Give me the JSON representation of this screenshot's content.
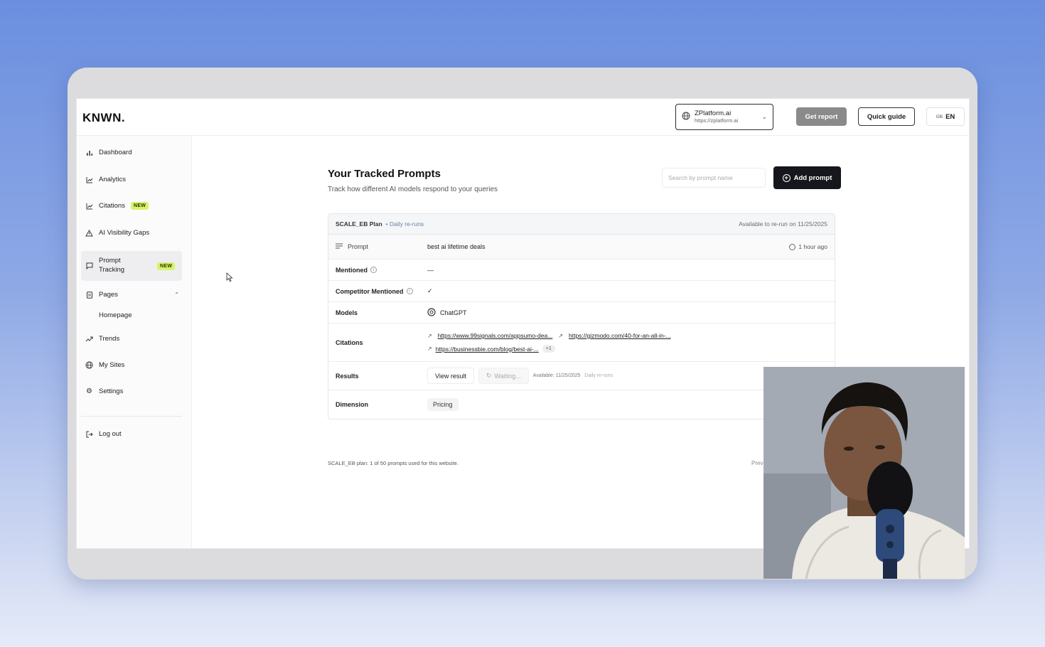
{
  "app": {
    "logo": "KNWN."
  },
  "header": {
    "site_name": "ZPlatform.ai",
    "site_url": "https://zplatform.ai",
    "get_report_label": "Get report",
    "quick_guide_label": "Quick guide",
    "lang_flag": "GB",
    "lang_code": "EN"
  },
  "sidebar": {
    "items": [
      {
        "label": "Dashboard",
        "icon": "bar-chart-icon"
      },
      {
        "label": "Analytics",
        "icon": "line-chart-icon"
      },
      {
        "label": "Citations",
        "icon": "line-chart-icon",
        "badge": "NEW"
      },
      {
        "label": "AI Visibility Gaps",
        "icon": "warning-triangle-icon"
      },
      {
        "label": "Prompt Tracking",
        "icon": "chat-bubble-icon",
        "badge": "NEW",
        "active": true
      },
      {
        "label": "Pages",
        "icon": "document-icon",
        "expanded": true
      },
      {
        "label": "Homepage"
      },
      {
        "label": "Trends",
        "icon": "trending-up-icon"
      },
      {
        "label": "My Sites",
        "icon": "globe-icon"
      },
      {
        "label": "Settings",
        "icon": "gear-icon"
      },
      {
        "label": "Log out",
        "icon": "logout-icon"
      }
    ]
  },
  "main": {
    "title": "Your Tracked Prompts",
    "subtitle": "Track how different AI models respond to your queries",
    "search_placeholder": "Search by prompt name",
    "add_prompt_label": "Add prompt"
  },
  "card": {
    "plan": "SCALE_EB Plan",
    "runs": "• Daily re-runs",
    "available": "Available to re-run on 11/25/2025",
    "prompt_label": "Prompt",
    "prompt_value": "best ai lifetime deals",
    "prompt_time": "1 hour ago",
    "mentioned_label": "Mentioned",
    "mentioned_value": "—",
    "competitor_label": "Competitor Mentioned",
    "competitor_value": "✓",
    "models_label": "Models",
    "models_value": "ChatGPT",
    "citations_label": "Citations",
    "citations": [
      "https://www.99signals.com/appsumo-dea...",
      "https://gizmodo.com/40-for-an-all-in-...",
      "https://businessbie.com/blog/best-ai-..."
    ],
    "citations_more": "+1",
    "results_label": "Results",
    "view_result_label": "View result",
    "waiting_label": "Waiting...",
    "results_available": "Available: 11/25/2025",
    "results_runs": "Daily re-runs",
    "dimension_label": "Dimension",
    "dimension_value": "Pricing"
  },
  "footer": {
    "note": "SCALE_EB plan: 1 of 50 prompts used for this website.",
    "prev": "Prev"
  }
}
